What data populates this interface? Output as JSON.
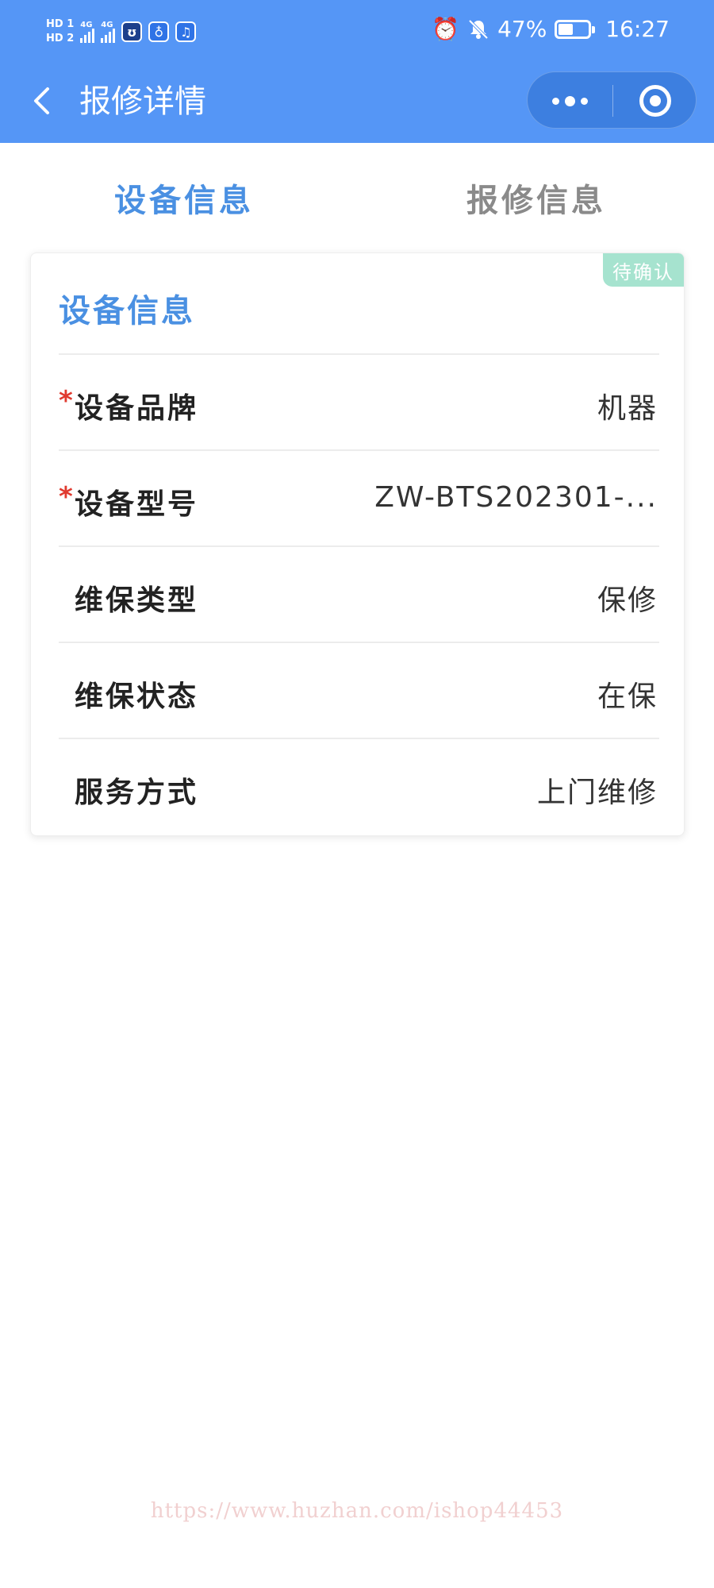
{
  "status_bar": {
    "hd1": "HD 1",
    "hd2": "HD 2",
    "net1": "4G",
    "net2": "4G",
    "battery": "47%",
    "time": "16:27"
  },
  "navbar": {
    "title": "报修详情"
  },
  "tabs": [
    {
      "label": "设备信息",
      "active": true
    },
    {
      "label": "报修信息",
      "active": false
    }
  ],
  "card": {
    "badge": "待确认",
    "title": "设备信息",
    "rows": [
      {
        "required": true,
        "label": "设备品牌",
        "value": "机器"
      },
      {
        "required": true,
        "label": "设备型号",
        "value": "ZW-BTS202301-..."
      },
      {
        "required": false,
        "label": "维保类型",
        "value": "保修"
      },
      {
        "required": false,
        "label": "维保状态",
        "value": "在保"
      },
      {
        "required": false,
        "label": "服务方式",
        "value": "上门维修"
      }
    ]
  },
  "watermark": "https://www.huzhan.com/ishop44453",
  "colors": {
    "header_bg": "#5596f6",
    "accent": "#4a90e2",
    "required": "#e03a2f",
    "badge_bg": "#a6e3cf"
  }
}
